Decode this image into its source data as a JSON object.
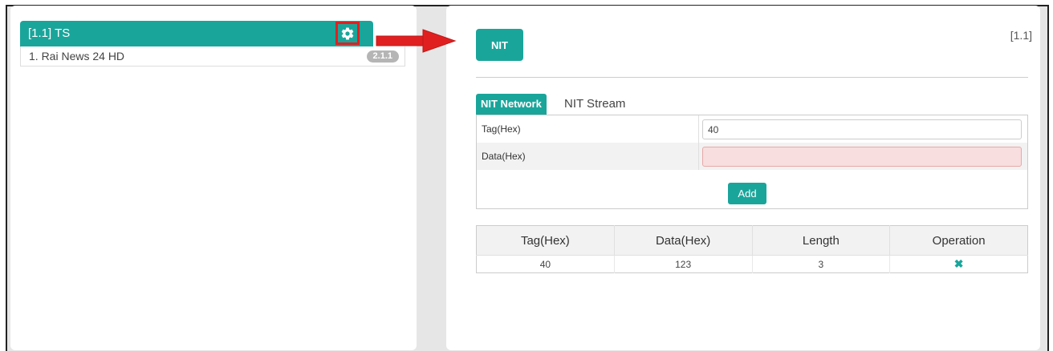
{
  "left_panel": {
    "ts_header": "[1.1] TS",
    "items": [
      {
        "label": "1. Rai News 24 HD",
        "badge": "2.1.1"
      }
    ]
  },
  "right_panel": {
    "nit_button": "NIT",
    "corner_label": "[1.1]",
    "tabs": [
      "NIT Network",
      "NIT Stream"
    ],
    "form": {
      "tag_label": "Tag(Hex)",
      "tag_value": "40",
      "data_label": "Data(Hex)",
      "data_value": "",
      "add_button": "Add"
    },
    "table": {
      "headers": [
        "Tag(Hex)",
        "Data(Hex)",
        "Length",
        "Operation"
      ],
      "rows": [
        {
          "tag": "40",
          "data": "123",
          "length": "3",
          "operation": "delete"
        }
      ]
    }
  },
  "colors": {
    "accent": "#1aa59b",
    "highlight": "#e02020"
  },
  "icons": {
    "settings": "gear-icon",
    "arrow": "arrow-right-icon",
    "delete": "close-icon"
  }
}
